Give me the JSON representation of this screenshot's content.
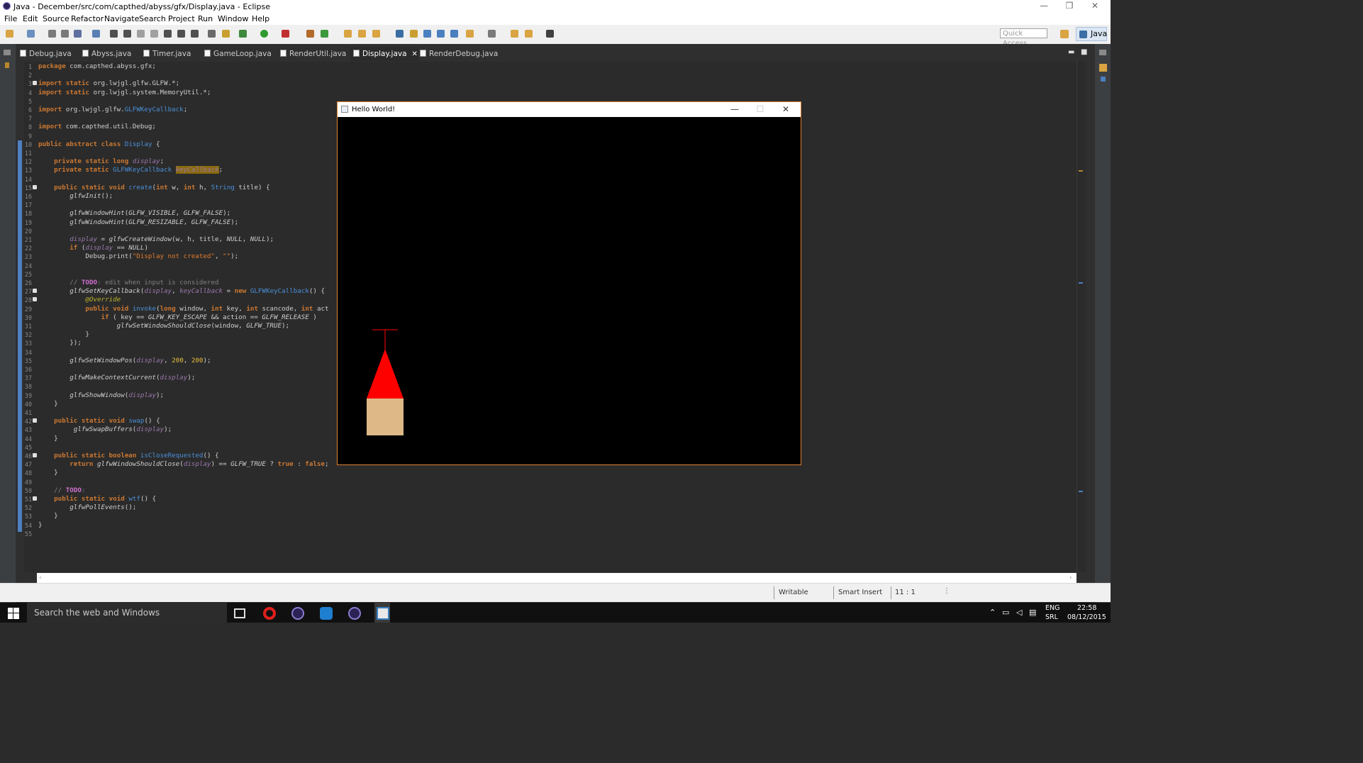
{
  "window": {
    "title": "Java - December/src/com/capthed/abyss/gfx/Display.java - Eclipse",
    "minimize": "—",
    "maximize": "❐",
    "close": "✕"
  },
  "menu": [
    "File",
    "Edit",
    "Source",
    "Refactor",
    "Navigate",
    "Search",
    "Project",
    "Run",
    "Window",
    "Help"
  ],
  "toolbar": {
    "quick_access_placeholder": "Quick Access",
    "perspective": "Java"
  },
  "tabs": [
    {
      "label": "Debug.java"
    },
    {
      "label": "Abyss.java"
    },
    {
      "label": "Timer.java"
    },
    {
      "label": "GameLoop.java"
    },
    {
      "label": "RenderUtil.java"
    },
    {
      "label": "Display.java",
      "active": true,
      "close": "✕"
    },
    {
      "label": "RenderDebug.java"
    }
  ],
  "code_lines": [
    "package com.capthed.abyss.gfx;",
    "",
    "import static org.lwjgl.glfw.GLFW.*;",
    "import static org.lwjgl.system.MemoryUtil.*;",
    "",
    "import org.lwjgl.glfw.GLFWKeyCallback;",
    "",
    "import com.capthed.util.Debug;",
    "",
    "public abstract class Display {",
    "",
    "    private static long display;",
    "    private static GLFWKeyCallback keyCallback;",
    "",
    "    public static void create(int w, int h, String title) {",
    "        glfwInit();",
    "",
    "        glfwWindowHint(GLFW_VISIBLE, GLFW_FALSE);",
    "        glfwWindowHint(GLFW_RESIZABLE, GLFW_FALSE);",
    "",
    "        display = glfwCreateWindow(w, h, title, NULL, NULL);",
    "        if (display == NULL)",
    "            Debug.print(\"Display not created\", \"\");",
    "",
    "",
    "        // TODO: edit when input is considered",
    "        glfwSetKeyCallback(display, keyCallback = new GLFWKeyCallback() {",
    "            @Override",
    "            public void invoke(long window, int key, int scancode, int act",
    "                if ( key == GLFW_KEY_ESCAPE && action == GLFW_RELEASE )",
    "                    glfwSetWindowShouldClose(window, GLFW_TRUE);",
    "            }",
    "        });",
    "",
    "        glfwSetWindowPos(display, 200, 200);",
    "",
    "        glfwMakeContextCurrent(display);",
    "",
    "        glfwShowWindow(display);",
    "    }",
    "",
    "    public static void swap() {",
    "         glfwSwapBuffers(display);",
    "    }",
    "",
    "    public static boolean isCloseRequested() {",
    "        return glfwWindowShouldClose(display) == GLFW_TRUE ? true : false;",
    "    }",
    "",
    "    // TODO:",
    "    public static void wtf() {",
    "        glfwPollEvents();",
    "    }",
    "}",
    ""
  ],
  "hello_window": {
    "title": "Hello World!",
    "minimize": "—",
    "maximize": "☐",
    "close": "✕"
  },
  "statusbar": {
    "mode": "Writable",
    "insert": "Smart Insert",
    "position": "11 : 1"
  },
  "taskbar": {
    "search_placeholder": "Search the web and Windows",
    "lang": "ENG",
    "layout": "SRL",
    "time": "22:58",
    "date": "08/12/2015"
  },
  "colors": {
    "keyword": "#cc7832",
    "field": "#9876aa",
    "string": "#e07a2e",
    "type": "#4a8fd8",
    "comment": "#808080",
    "todo": "#d070d0",
    "annotation": "#bbb529",
    "method_static": "#d0d0d0",
    "number": "#e8c040"
  }
}
